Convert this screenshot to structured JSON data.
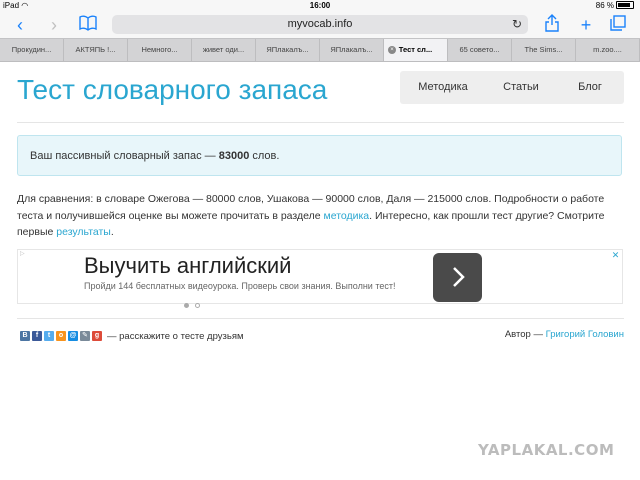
{
  "status": {
    "device": "iPad",
    "wifi": "wifi-icon",
    "time": "16:00",
    "battery": "86 %",
    "battery_level": 0.86
  },
  "browser": {
    "url": "myvocab.info",
    "tabs": [
      {
        "label": "Прокудин..."
      },
      {
        "label": "АКТЯПЬ !..."
      },
      {
        "label": "Немного..."
      },
      {
        "label": "живет оди..."
      },
      {
        "label": "ЯПлакалъ..."
      },
      {
        "label": "ЯПлакалъ..."
      },
      {
        "label": "Тест сл...",
        "active": true
      },
      {
        "label": "65 совето..."
      },
      {
        "label": "The Sims..."
      },
      {
        "label": "m.zoo...."
      }
    ]
  },
  "page": {
    "title": "Тест словарного запаса",
    "nav": [
      {
        "label": "Методика"
      },
      {
        "label": "Статьи"
      },
      {
        "label": "Блог"
      }
    ],
    "result": {
      "prefix": "Ваш пассивный словарный запас — ",
      "value": "83000",
      "suffix": " слов."
    },
    "para": {
      "part1": "Для сравнения: в словаре Ожегова — 80000 слов, Ушакова — 90000 слов, Даля — 215000 слов. Подробности о работе теста и получившейся оценке вы можете прочитать в разделе ",
      "link1": "методика",
      "part2": ". Интересно, как прошли тест другие? Смотрите первые ",
      "link2": "результаты",
      "part3": "."
    },
    "ad": {
      "headline": "Выучить английский",
      "sub": "Пройди 144 бесплатных видеоурока. Проверь свои знания. Выполни тест!",
      "slides": 2,
      "active_slide": 1
    },
    "share_text": "— расскажите о тесте друзьям",
    "author_label": "Автор — ",
    "author_name": "Григорий Головин"
  },
  "watermark": "YAPLAKAL.COM"
}
